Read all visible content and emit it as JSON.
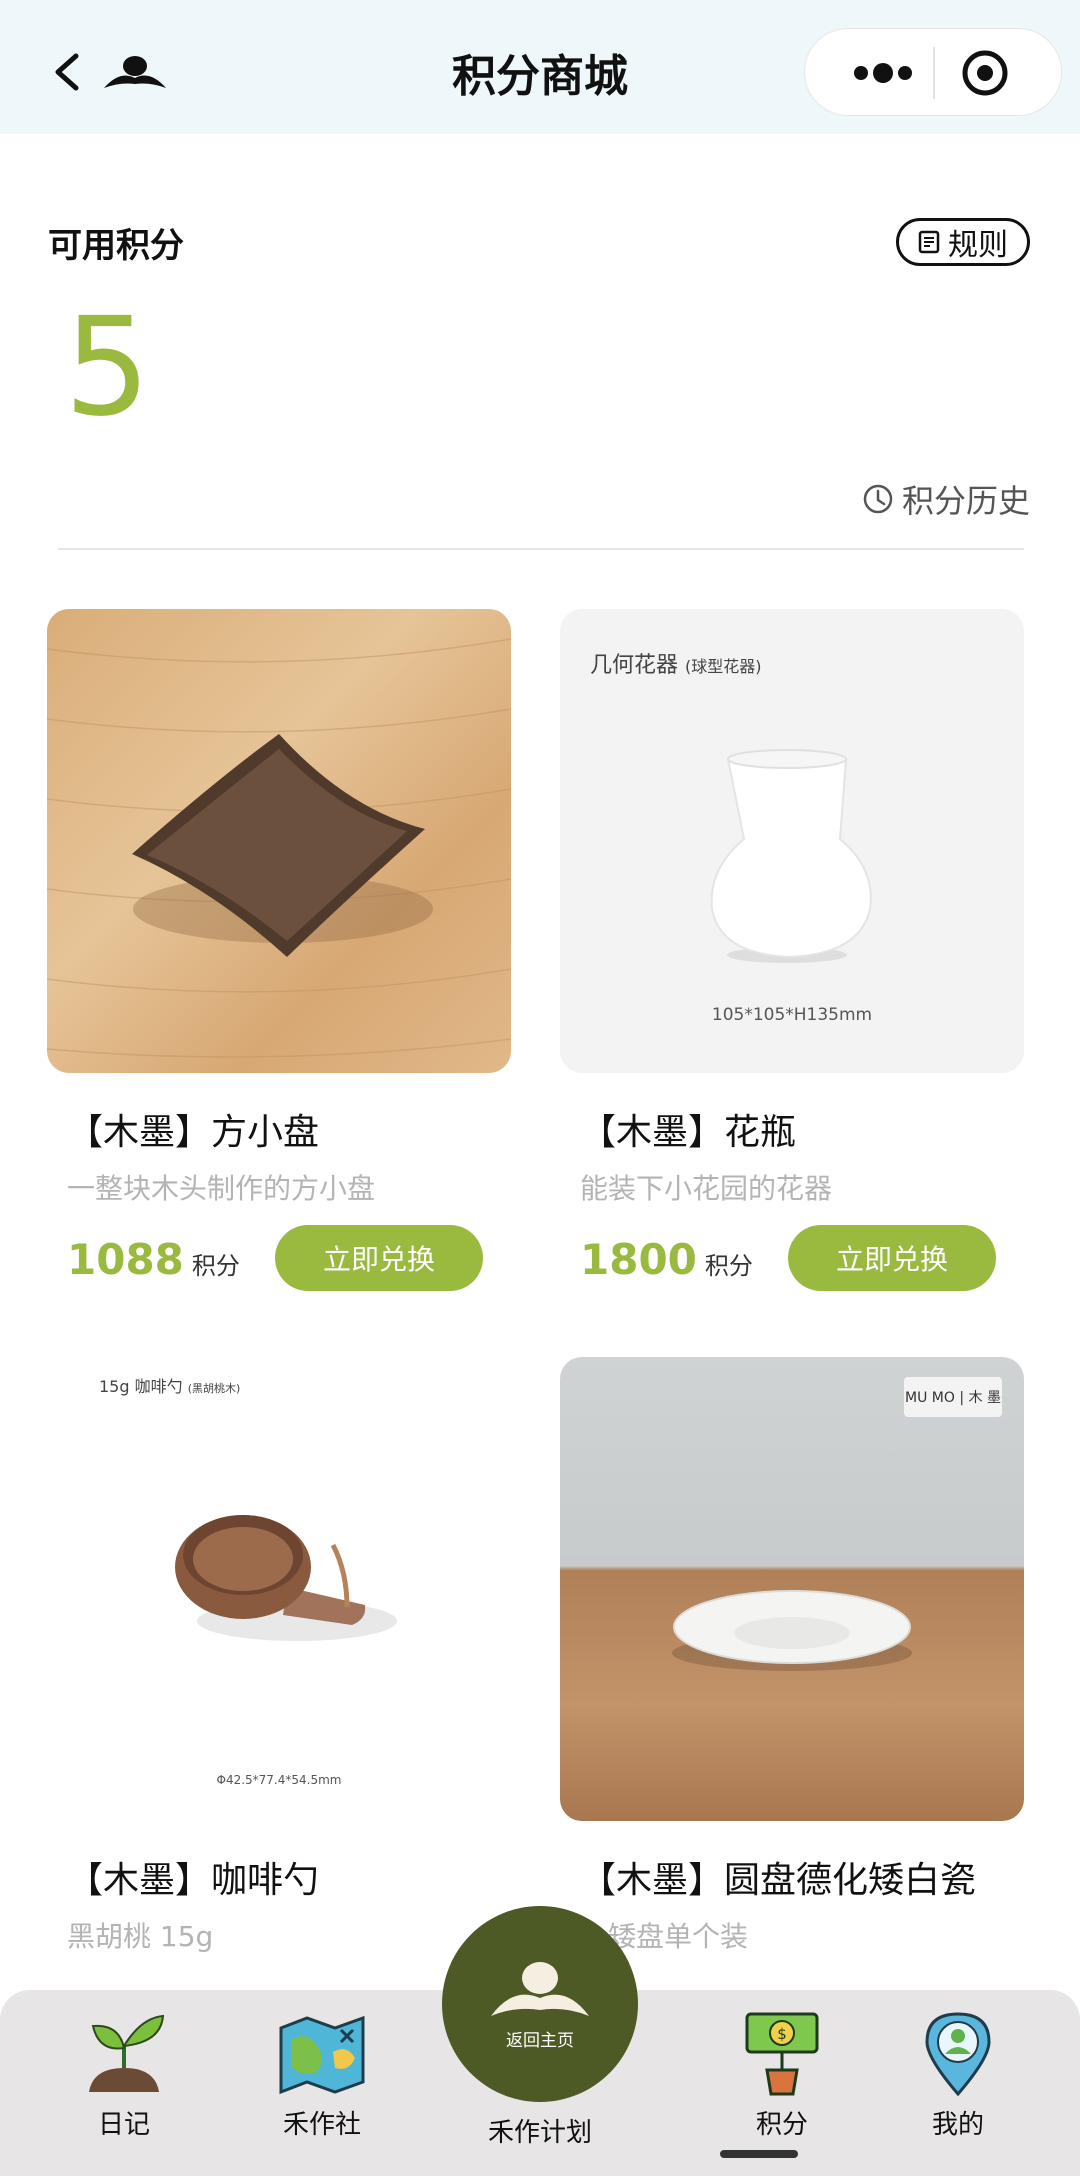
{
  "header": {
    "title": "积分商城"
  },
  "points": {
    "label": "可用积分",
    "value": "5",
    "rules_label": "规则",
    "history_label": "积分历史"
  },
  "products": [
    {
      "name": "【木墨】方小盘",
      "desc": "一整块木头制作的方小盘",
      "price": "1088",
      "unit": "积分",
      "redeem_label": "立即兑换"
    },
    {
      "name": "【木墨】花瓶",
      "desc": "能装下小花园的花器",
      "price": "1800",
      "unit": "积分",
      "redeem_label": "立即兑换",
      "image_caption": "几何花器",
      "image_caption_small": "(球型花器)",
      "image_dims": "105*105*H135mm"
    },
    {
      "name": "【木墨】咖啡勺",
      "desc": "黑胡桃 15g",
      "image_caption": "15g 咖啡勺",
      "image_caption_small": "(黑胡桃木)",
      "image_dims": "Φ42.5*77.4*54.5mm"
    },
    {
      "name": "【木墨】圆盘德化矮白瓷",
      "desc": "小矮盘单个装",
      "brand_tag": "MU MO | 木 墨"
    }
  ],
  "home_button": {
    "label": "返回主页"
  },
  "tabs": [
    {
      "label": "日记",
      "icon": "sprout-icon"
    },
    {
      "label": "禾作社",
      "icon": "map-icon"
    },
    {
      "label": "禾作计划",
      "icon": "home-logo-icon"
    },
    {
      "label": "积分",
      "icon": "money-plant-icon"
    },
    {
      "label": "我的",
      "icon": "profile-pin-icon"
    }
  ],
  "colors": {
    "accent": "#9ab93f",
    "home_button": "#4d5a26",
    "header_bg": "#eef7f9"
  }
}
